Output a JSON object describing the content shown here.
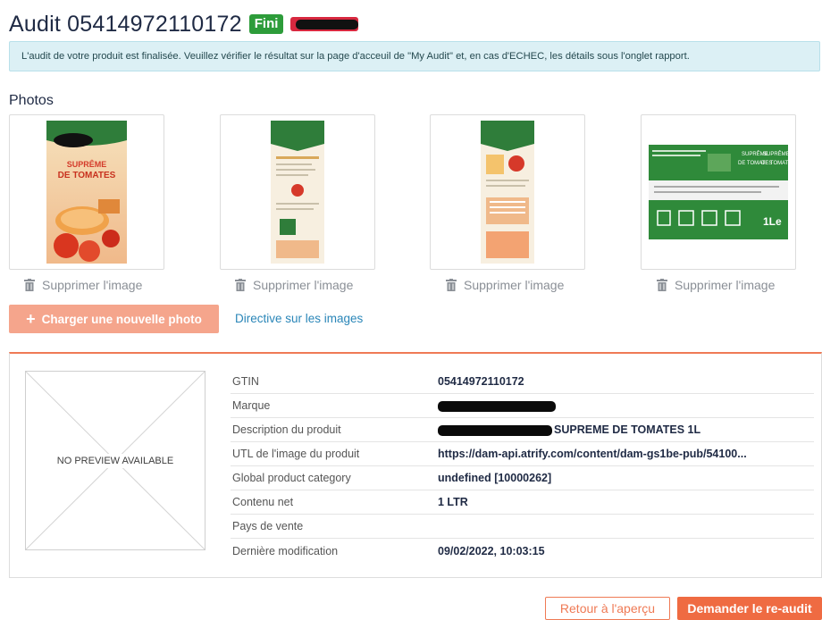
{
  "header": {
    "title": "Audit 05414972110172",
    "status_badge": "Fini"
  },
  "alert": {
    "message": "L'audit de votre produit est finalisée. Veuillez vérifier le résultat sur la page d'acceuil de \"My Audit\" et, en cas d'ECHEC, les détails sous l'onglet rapport."
  },
  "photos": {
    "section_title": "Photos",
    "delete_label": "Supprimer l'image",
    "items": [
      {
        "front_text_1": "SUPRÊME",
        "front_text_2": "DE TOMATES"
      },
      {},
      {},
      {
        "side_text_1": "SUPRÊME",
        "side_text_2": "DE TOMATES",
        "volume": "1Le"
      }
    ],
    "upload_label": "Charger une nouvelle photo",
    "guideline_link": "Directive sur les images"
  },
  "details": {
    "preview_text": "NO PREVIEW AVAILABLE",
    "rows": [
      {
        "label": "GTIN",
        "value": "05414972110172"
      },
      {
        "label": "Marque",
        "value": ""
      },
      {
        "label": "Description du produit",
        "value": "SUPREME DE TOMATES 1L"
      },
      {
        "label": "UTL de l'image du produit",
        "value": "https://dam-api.atrify.com/content/dam-gs1be-pub/54100..."
      },
      {
        "label": "Global product category",
        "value": "undefined [10000262]"
      },
      {
        "label": "Contenu net",
        "value": "1 LTR"
      },
      {
        "label": "Pays de vente",
        "value": ""
      },
      {
        "label": "Dernière modification",
        "value": "09/02/2022, 10:03:15"
      }
    ]
  },
  "footer": {
    "back_label": "Retour à l'aperçu",
    "reaudit_label": "Demander le re-audit"
  },
  "colors": {
    "accent": "#ef6b42",
    "success": "#2d9c3a",
    "alert_bg": "#dcf0f5",
    "link": "#2a86b8"
  }
}
